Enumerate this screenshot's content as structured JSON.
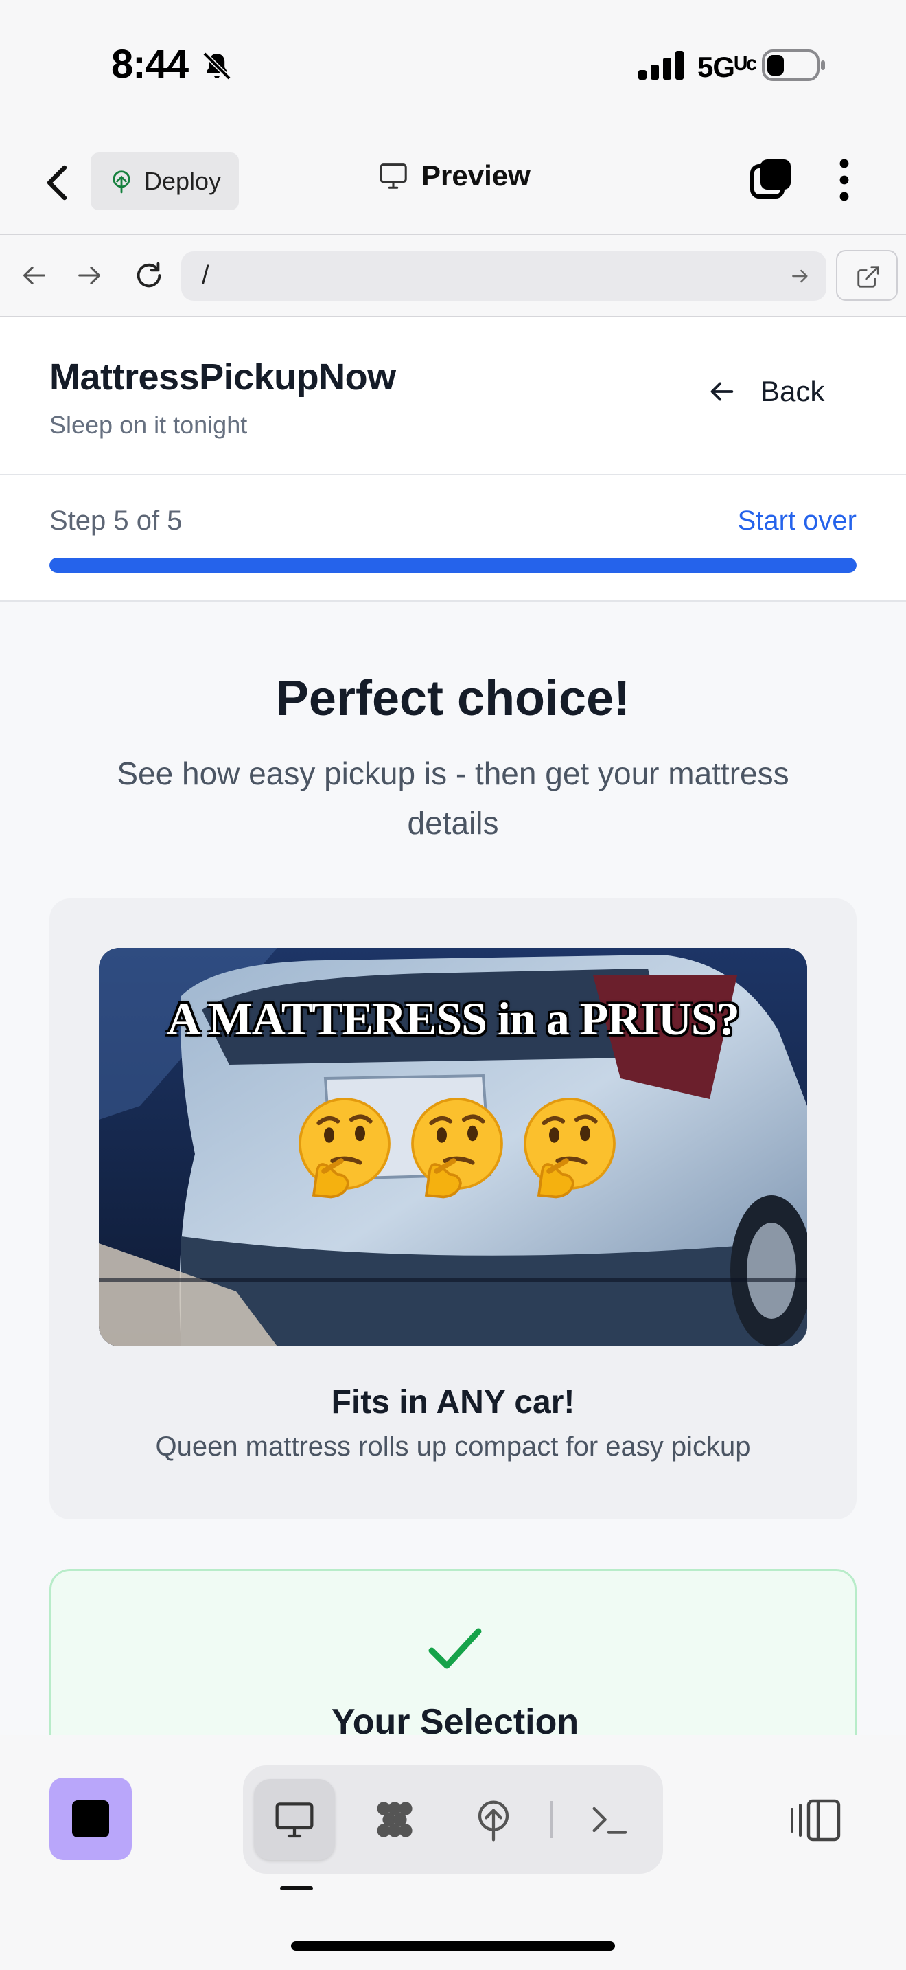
{
  "status_bar": {
    "time": "8:44",
    "network": "5Gᵁᶜ",
    "icons": [
      "bell-slash-icon",
      "signal-bars-icon",
      "battery-icon"
    ]
  },
  "app_header": {
    "deploy_label": "Deploy",
    "preview_label": "Preview",
    "icons": [
      "chevron-left-icon",
      "deploy-icon",
      "monitor-icon",
      "tabs-icon",
      "more-vertical-icon"
    ]
  },
  "url_bar": {
    "url": "/",
    "icons": [
      "arrow-left-icon",
      "arrow-right-icon",
      "reload-icon",
      "go-arrow-icon",
      "open-external-icon"
    ]
  },
  "site": {
    "brand": "MattressPickupNow",
    "tagline": "Sleep on it tonight",
    "back_label": "Back"
  },
  "steps": {
    "label": "Step 5 of 5",
    "start_over": "Start over",
    "progress": 1.0
  },
  "main": {
    "headline": "Perfect choice!",
    "subhead": "See how easy pickup is - then get your mattress details",
    "media": {
      "caption": "A MATTERESS in a PRIUS?",
      "emoji": "thinking-face-emoji",
      "title": "Fits in ANY car!",
      "subtitle": "Queen mattress rolls up compact for easy pickup"
    },
    "selection": {
      "title": "Your Selection"
    }
  },
  "bottom_toolbar": {
    "tools": [
      "monitor-icon",
      "integrations-icon",
      "deploy-icon",
      "terminal-icon"
    ],
    "active_tool": "monitor-icon",
    "colors": {
      "stop_button": "#b9a6fa",
      "accent": "#2563eb",
      "success": "#16a34a"
    }
  }
}
